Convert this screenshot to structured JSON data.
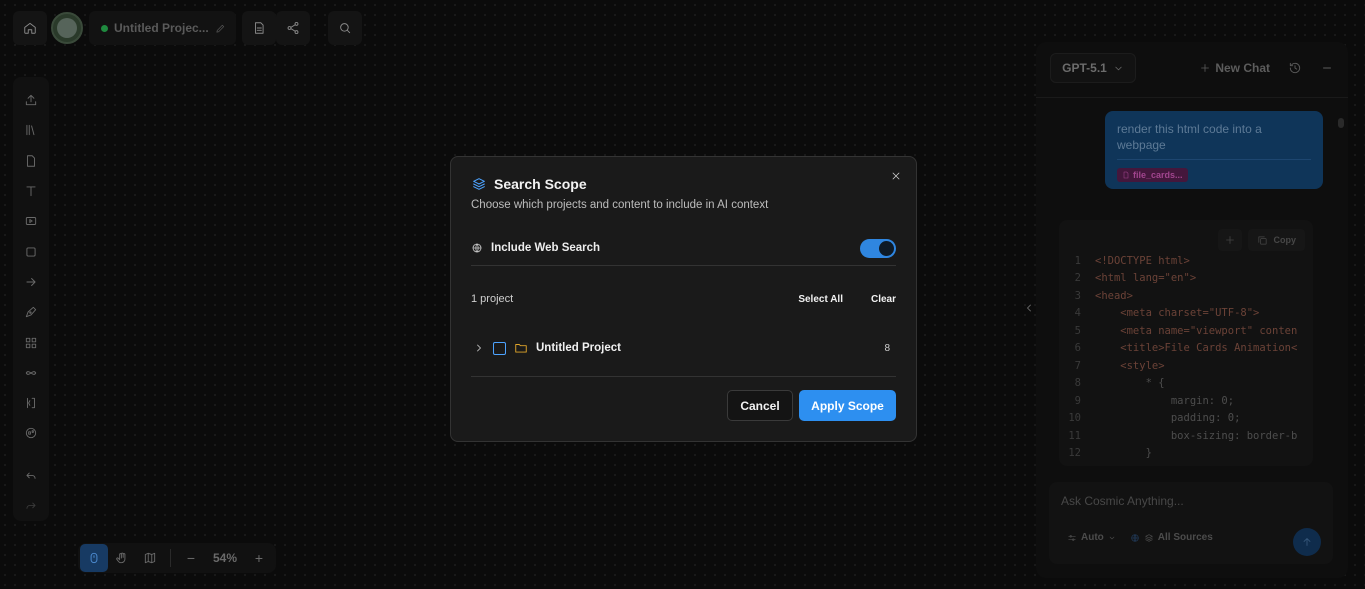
{
  "topbar": {
    "project_title": "Untitled Projec...",
    "icons": [
      "home-icon",
      "avatar",
      "pencil-icon",
      "document-icon",
      "share-icon",
      "search-icon"
    ]
  },
  "left_toolbar": {
    "icons": [
      "upload-icon",
      "library-icon",
      "file-icon",
      "text-icon",
      "video-icon",
      "square-icon",
      "arrow-icon",
      "pen-icon",
      "grid-icon",
      "shuffle-icon",
      "code-icon",
      "globe-icon",
      "undo-icon",
      "redo-icon"
    ]
  },
  "bottom_toolbar": {
    "zoom": "54%",
    "minus": "−",
    "plus": "+"
  },
  "right_panel": {
    "model": "GPT-5.1",
    "new_chat": "New Chat",
    "user_message": "render this html code into a webpage",
    "file_chip": "file_cards...",
    "copy_label": "Copy",
    "code_lines": [
      {
        "n": "1",
        "t": "<!DOCTYPE html>"
      },
      {
        "n": "2",
        "t": "<html lang=\"en\">"
      },
      {
        "n": "3",
        "t": "<head>"
      },
      {
        "n": "4",
        "t": "    <meta charset=\"UTF-8\">"
      },
      {
        "n": "5",
        "t": "    <meta name=\"viewport\" conten"
      },
      {
        "n": "6",
        "t": "    <title>File Cards Animation<"
      },
      {
        "n": "7",
        "t": "    <style>"
      },
      {
        "n": "8",
        "t": "        * {"
      },
      {
        "n": "9",
        "t": "            margin: 0;"
      },
      {
        "n": "10",
        "t": "            padding: 0;"
      },
      {
        "n": "11",
        "t": "            box-sizing: border-b"
      },
      {
        "n": "12",
        "t": "        }"
      }
    ],
    "input_placeholder": "Ask Cosmic Anything...",
    "auto_label": "Auto",
    "sources_label": "All Sources"
  },
  "modal": {
    "title": "Search Scope",
    "subtitle": "Choose which projects and content to include in AI context",
    "web_search_label": "Include Web Search",
    "web_search_enabled": true,
    "project_count": "1 project",
    "select_all": "Select All",
    "clear": "Clear",
    "projects": [
      {
        "name": "Untitled Project",
        "count": "8"
      }
    ],
    "cancel": "Cancel",
    "apply": "Apply Scope"
  },
  "colors": {
    "accent": "#2d8ff0",
    "folder": "#e0a52a",
    "modal_bg": "#1a1a1a"
  }
}
